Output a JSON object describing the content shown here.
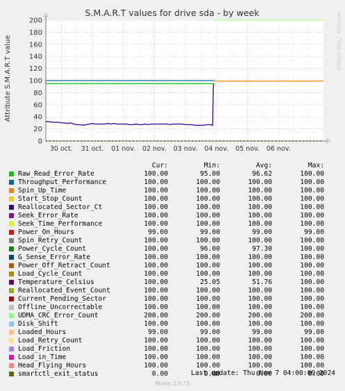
{
  "chart_data": {
    "type": "line",
    "title": "S.M.A.R.T values for drive sda - by week",
    "ylabel": "Attribute S.M.A.R.T value",
    "watermark": "RRDTOOL / TOBI OETIKER",
    "ylim": [
      0,
      200
    ],
    "y_ticks": [
      0,
      20,
      40,
      60,
      80,
      100,
      120,
      140,
      160,
      180,
      200
    ],
    "xlim": [
      0,
      8.95
    ],
    "x_ticks": [
      {
        "x": 0.5,
        "label": "30 oct."
      },
      {
        "x": 1.5,
        "label": "31 oct."
      },
      {
        "x": 2.5,
        "label": "01 nov."
      },
      {
        "x": 3.5,
        "label": "02 nov."
      },
      {
        "x": 4.5,
        "label": "03 nov."
      },
      {
        "x": 5.5,
        "label": "04 nov."
      },
      {
        "x": 6.5,
        "label": "05 nov."
      },
      {
        "x": 7.5,
        "label": "06 nov."
      }
    ],
    "grid": true,
    "series_plot": [
      {
        "name": "UDMA_CRC_Error_Count",
        "color": "#b2ff7f",
        "points": [
          [
            5.42,
            200
          ],
          [
            8.95,
            200
          ]
        ]
      },
      {
        "name": "Power_On_Hours",
        "color": "#ff8800",
        "points": [
          [
            5.42,
            99
          ],
          [
            8.95,
            99
          ]
        ]
      },
      {
        "name": "Throughput_Performance",
        "color": "#0066b3",
        "points": [
          [
            0,
            100
          ],
          [
            5.42,
            100
          ]
        ]
      },
      {
        "name": "Raw_Read_Error_Rate",
        "color": "#00cc00",
        "points": [
          [
            0,
            95
          ],
          [
            5.42,
            95
          ]
        ]
      },
      {
        "name": "Temperature_Celsius",
        "color": "#330099",
        "points": [
          [
            0,
            32
          ],
          [
            0.1,
            32
          ],
          [
            0.2,
            31
          ],
          [
            0.3,
            31
          ],
          [
            0.4,
            31
          ],
          [
            0.5,
            30
          ],
          [
            0.6,
            30
          ],
          [
            0.7,
            29
          ],
          [
            0.8,
            30
          ],
          [
            0.9,
            28
          ],
          [
            1.0,
            27
          ],
          [
            1.1,
            27
          ],
          [
            1.2,
            26
          ],
          [
            1.3,
            27
          ],
          [
            1.4,
            28
          ],
          [
            1.5,
            29
          ],
          [
            1.6,
            28
          ],
          [
            1.7,
            28
          ],
          [
            1.8,
            28
          ],
          [
            1.9,
            28
          ],
          [
            2.0,
            29
          ],
          [
            2.1,
            28
          ],
          [
            2.2,
            29
          ],
          [
            2.3,
            28
          ],
          [
            2.4,
            28
          ],
          [
            2.5,
            28
          ],
          [
            2.6,
            28
          ],
          [
            2.7,
            27
          ],
          [
            2.8,
            27
          ],
          [
            2.9,
            28
          ],
          [
            3.0,
            27
          ],
          [
            3.1,
            27
          ],
          [
            3.2,
            28
          ],
          [
            3.3,
            27
          ],
          [
            3.4,
            28
          ],
          [
            3.5,
            28
          ],
          [
            3.6,
            28
          ],
          [
            3.7,
            28
          ],
          [
            3.8,
            28
          ],
          [
            3.9,
            28
          ],
          [
            4.0,
            27
          ],
          [
            4.1,
            28
          ],
          [
            4.2,
            28
          ],
          [
            4.3,
            28
          ],
          [
            4.4,
            28
          ],
          [
            4.5,
            27
          ],
          [
            4.6,
            27
          ],
          [
            4.7,
            27
          ],
          [
            4.8,
            26
          ],
          [
            4.9,
            26
          ],
          [
            5.0,
            26
          ],
          [
            5.1,
            26
          ],
          [
            5.2,
            27
          ],
          [
            5.3,
            27
          ],
          [
            5.38,
            26
          ],
          [
            5.4,
            91
          ],
          [
            5.42,
            95
          ]
        ]
      },
      {
        "name": "smartctl_exit_status",
        "color": "#666600",
        "dashed": true,
        "points": [
          [
            0,
            0
          ],
          [
            8.95,
            0
          ]
        ]
      }
    ]
  },
  "legend": {
    "headers": {
      "cur": "Cur:",
      "min": "Min:",
      "avg": "Avg:",
      "max": "Max:"
    },
    "rows": [
      {
        "name": "Raw_Read_Error_Rate",
        "color": "#00cc00",
        "cur": "100.00",
        "min": "95.00",
        "avg": "96.62",
        "max": "100.00"
      },
      {
        "name": "Throughput_Performance",
        "color": "#0066b3",
        "cur": "100.00",
        "min": "100.00",
        "avg": "100.00",
        "max": "100.00"
      },
      {
        "name": "Spin_Up_Time",
        "color": "#ff8000",
        "cur": "100.00",
        "min": "100.00",
        "avg": "100.00",
        "max": "100.00"
      },
      {
        "name": "Start_Stop_Count",
        "color": "#ffcc00",
        "cur": "100.00",
        "min": "100.00",
        "avg": "100.00",
        "max": "100.00"
      },
      {
        "name": "Reallocated_Sector_Ct",
        "color": "#330099",
        "cur": "100.00",
        "min": "100.00",
        "avg": "100.00",
        "max": "100.00"
      },
      {
        "name": "Seek_Error_Rate",
        "color": "#990099",
        "cur": "100.00",
        "min": "100.00",
        "avg": "100.00",
        "max": "100.00"
      },
      {
        "name": "Seek_Time_Performance",
        "color": "#ccff00",
        "cur": "100.00",
        "min": "100.00",
        "avg": "100.00",
        "max": "100.00"
      },
      {
        "name": "Power_On_Hours",
        "color": "#ff0000",
        "cur": "99.00",
        "min": "99.00",
        "avg": "99.00",
        "max": "99.00"
      },
      {
        "name": "Spin_Retry_Count",
        "color": "#808080",
        "cur": "100.00",
        "min": "100.00",
        "avg": "100.00",
        "max": "100.00"
      },
      {
        "name": "Power_Cycle_Count",
        "color": "#008f00",
        "cur": "100.00",
        "min": "96.00",
        "avg": "97.30",
        "max": "100.00"
      },
      {
        "name": "G_Sense_Error_Rate",
        "color": "#00487d",
        "cur": "100.00",
        "min": "100.00",
        "avg": "100.00",
        "max": "100.00"
      },
      {
        "name": "Power_Off_Retract_Count",
        "color": "#b35a00",
        "cur": "100.00",
        "min": "100.00",
        "avg": "100.00",
        "max": "100.00"
      },
      {
        "name": "Load_Cycle_Count",
        "color": "#b38f00",
        "cur": "100.00",
        "min": "100.00",
        "avg": "100.00",
        "max": "100.00"
      },
      {
        "name": "Temperature_Celsius",
        "color": "#6b006b",
        "cur": "100.00",
        "min": "25.05",
        "avg": "51.76",
        "max": "100.00"
      },
      {
        "name": "Reallocated_Event_Count",
        "color": "#8fb300",
        "cur": "100.00",
        "min": "100.00",
        "avg": "100.00",
        "max": "100.00"
      },
      {
        "name": "Current_Pending_Sector",
        "color": "#b30000",
        "cur": "100.00",
        "min": "100.00",
        "avg": "100.00",
        "max": "100.00"
      },
      {
        "name": "Offline_Uncorrectable",
        "color": "#bebebe",
        "cur": "100.00",
        "min": "100.00",
        "avg": "100.00",
        "max": "100.00"
      },
      {
        "name": "UDMA_CRC_Error_Count",
        "color": "#80ff80",
        "cur": "200.00",
        "min": "200.00",
        "avg": "200.00",
        "max": "200.00"
      },
      {
        "name": "Disk_Shift",
        "color": "#80c9ff",
        "cur": "100.00",
        "min": "100.00",
        "avg": "100.00",
        "max": "100.00"
      },
      {
        "name": "Loaded_Hours",
        "color": "#ffc080",
        "cur": "99.00",
        "min": "99.00",
        "avg": "99.00",
        "max": "99.00"
      },
      {
        "name": "Load_Retry_Count",
        "color": "#ffe680",
        "cur": "100.00",
        "min": "100.00",
        "avg": "100.00",
        "max": "100.00"
      },
      {
        "name": "Load_Friction",
        "color": "#aa80ff",
        "cur": "100.00",
        "min": "100.00",
        "avg": "100.00",
        "max": "100.00"
      },
      {
        "name": "Load_in_Time",
        "color": "#ee00cc",
        "cur": "100.00",
        "min": "100.00",
        "avg": "100.00",
        "max": "100.00"
      },
      {
        "name": "Head_Flying_Hours",
        "color": "#ff8080",
        "cur": "100.00",
        "min": "100.00",
        "avg": "100.00",
        "max": "100.00"
      },
      {
        "name": "smartctl_exit_status",
        "color": "#666600",
        "cur": "0.00",
        "min": "0.00",
        "avg": "0.00",
        "max": "0.00"
      }
    ]
  },
  "footer": {
    "last_update": "Last update: Thu Nov  7 04:00:09 2024",
    "munin": "Munin 2.0.73"
  }
}
